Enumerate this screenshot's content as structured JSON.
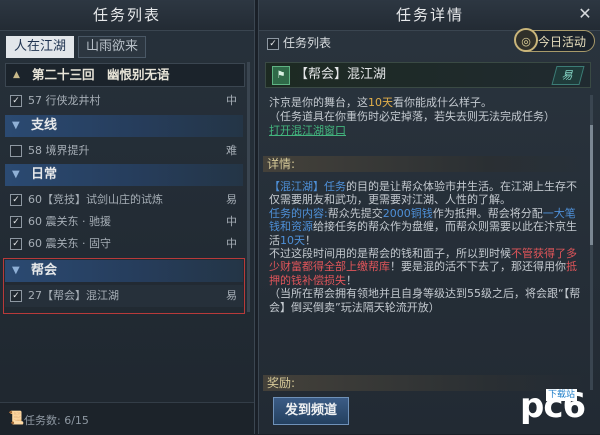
{
  "left": {
    "title": "任务列表",
    "tabs": [
      "人在江湖",
      "山雨欲来"
    ],
    "chapter": "第二十三回　幽恨别无语",
    "items": [
      {
        "label": "57 行侠龙井村",
        "diff": "中",
        "checked": true
      },
      {
        "label": "58 境界提升",
        "diff": "难",
        "checked": false
      },
      {
        "label": "60【竞技】试剑山庄的试炼",
        "diff": "易",
        "checked": true
      },
      {
        "label": "60 震关东 · 驰援",
        "diff": "中",
        "checked": true
      },
      {
        "label": "60 震关东 · 固守",
        "diff": "中",
        "checked": true
      },
      {
        "label": "27【帮会】混江湖",
        "diff": "易",
        "checked": true
      }
    ],
    "categories": [
      "支线",
      "日常",
      "帮会"
    ],
    "footer": "任务数: 6/15"
  },
  "right": {
    "title": "任务详情",
    "tasklist_toggle": "任务列表",
    "today": "今日活动",
    "quest_name": "【帮会】混江湖",
    "quest_badge": "易",
    "desc1_a": "汴京是你的舞台，这",
    "desc1_hl": "10天",
    "desc1_b": "看你能成什么样子。",
    "desc2": "（任务道具在你重伤时必定掉落，若失去则无法完成任务）",
    "link": "打开混江湖窗口",
    "sec_detail": "详情:",
    "d1": "【混江湖】任务",
    "d2": "的目的是让帮众体验市井生活。在江湖上生存不仅需要朋友和武功，更需要对江湖、人性的了解。",
    "d3": "任务的内容:",
    "d4": "帮众先提交",
    "d5": "2000铜钱",
    "d6": "作为抵押。帮会将分配",
    "d7": "一大笔钱和资源",
    "d8": "给接任务的帮众作为盘缠，而帮众则需要以此在汴京生活",
    "d9": "10天",
    "d10": "！",
    "d11": "不过这段时间用的是帮会的钱和面子，所以到时候",
    "d12": "不管获得了多少财富都得全部上缴帮库",
    "d13": "！要是混的活不下去了，那还得用你",
    "d14": "抵押的钱补偿损失",
    "d15": "！",
    "d16": "（当所在帮会拥有领地并且自身等级达到55级之后，将会跟“【帮会】倒买倒卖”玩法隔天轮流开放）",
    "sec_reward": "奖励:",
    "go_button": "发到频道"
  },
  "watermark": {
    "logo": "pc6",
    "tag": "下载站"
  },
  "colors": {
    "accent_blue": "#2b4a72",
    "highlight": "#e3b04b",
    "link_green": "#43b57e",
    "red_text": "#e0555a"
  }
}
